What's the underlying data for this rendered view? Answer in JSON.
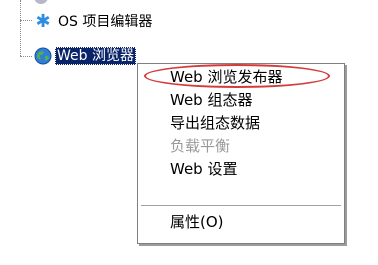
{
  "tree": {
    "nodes": [
      {
        "label": "OS 项目编辑器",
        "icon": "star-icon"
      },
      {
        "label": "Web 浏览器",
        "icon": "globe-icon",
        "selected": true
      }
    ]
  },
  "context_menu": {
    "items": [
      {
        "label": "Web 浏览发布器",
        "enabled": true
      },
      {
        "label": "Web 组态器",
        "enabled": true
      },
      {
        "label": "导出组态数据",
        "enabled": true
      },
      {
        "label": "负载平衡",
        "enabled": false
      },
      {
        "label": "Web 设置",
        "enabled": true
      },
      {
        "label": "属性(O)",
        "enabled": true
      }
    ]
  },
  "annotation": {
    "color": "#d33b3b"
  },
  "colors": {
    "selection": "#0a246a",
    "disabled_text": "#9a9a9a"
  }
}
